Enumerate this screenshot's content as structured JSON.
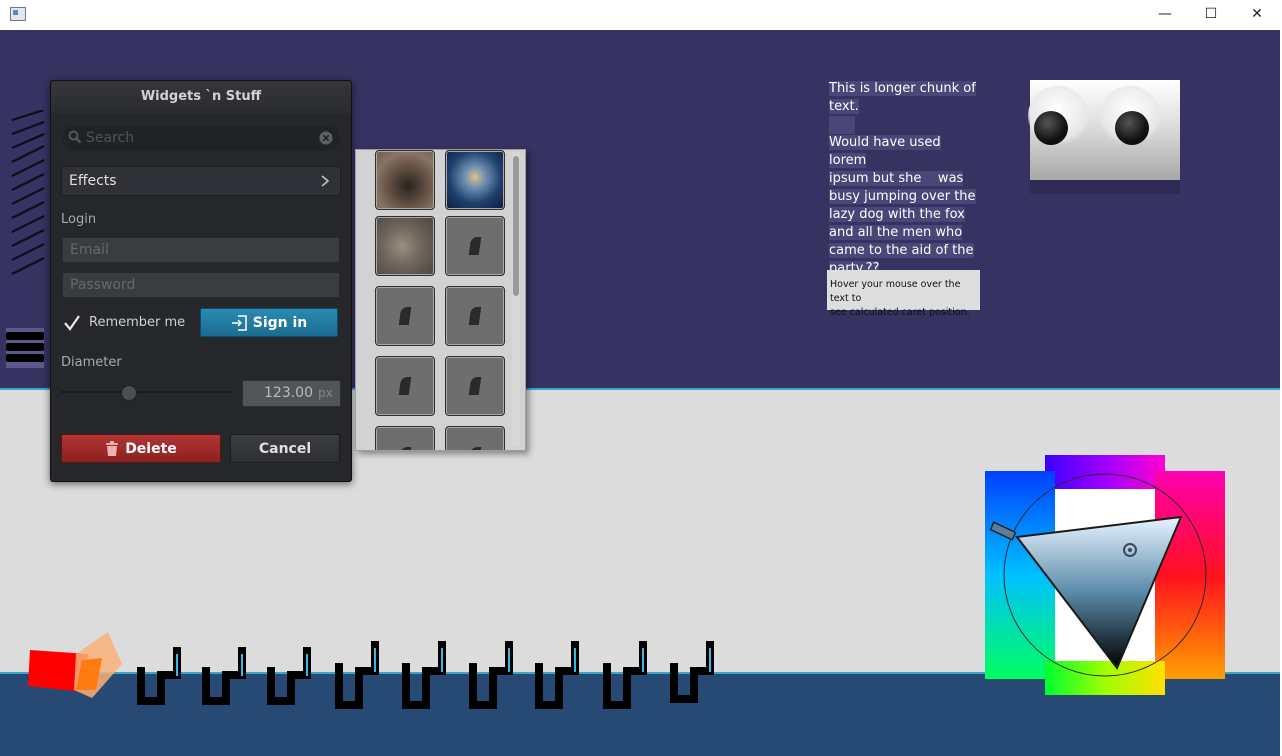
{
  "window": {
    "minimize_glyph": "—",
    "maximize_glyph": "☐",
    "close_glyph": "✕"
  },
  "panel": {
    "title": "Widgets `n Stuff",
    "search_placeholder": "Search",
    "effects_label": "Effects",
    "login_label": "Login",
    "email_placeholder": "Email",
    "password_placeholder": "Password",
    "remember_label": "Remember me",
    "remember_checked": true,
    "signin_label": "Sign in",
    "diameter_label": "Diameter",
    "diameter_value": "123.00",
    "diameter_unit": "px",
    "delete_label": "Delete",
    "cancel_label": "Cancel"
  },
  "image_grid": {
    "thumbnails": [
      "dog-nose-photo",
      "jellyfish-photo",
      "animal-photo",
      "empty",
      "empty",
      "empty",
      "empty",
      "empty",
      "empty",
      "empty"
    ]
  },
  "text_block": {
    "line1": "This is longer chunk of",
    "line2": "text.",
    "para2": [
      "Would have used lorem",
      "ipsum but she    was",
      "busy jumping over the",
      "lazy dog with the fox",
      "and all the men who",
      "came to the aid of the",
      "party.??"
    ],
    "caret_hint": [
      "Hover your mouse over the text to",
      "see calculated caret position."
    ]
  },
  "colors": {
    "top_bg": "#363262",
    "mid_bg": "#dcdcdc",
    "bottom_bg": "#274a75",
    "accent_line": "#3ba6c8",
    "signin_blue": "#1a7ca4",
    "delete_red": "#9b2626"
  },
  "icons": {
    "search": "search-icon",
    "clear": "clear-icon",
    "chevron": "chevron-right-icon",
    "check": "check-icon",
    "signin": "sign-in-icon",
    "trash": "trash-icon"
  }
}
